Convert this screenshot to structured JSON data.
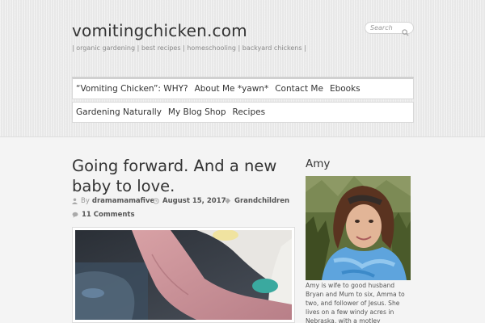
{
  "site": {
    "title": "vomitingchicken.com",
    "tagline": "| organic gardening | best recipes | homeschooling | backyard chickens |"
  },
  "search": {
    "placeholder": "Search"
  },
  "nav_primary": [
    "“Vomiting Chicken”: WHY?",
    "About Me *yawn*",
    "Contact Me",
    "Ebooks"
  ],
  "nav_secondary": [
    "Gardening Naturally",
    "My Blog Shop",
    "Recipes"
  ],
  "post": {
    "title": "Going forward. And a new baby to love.",
    "by_label": "By",
    "author": "dramamamafive",
    "date": "August 15, 2017",
    "category": "Grandchildren",
    "comments": "11 Comments"
  },
  "sidebar": {
    "title": "Amy",
    "bio": "Amy is wife to good husband Bryan and Mum to six, Amma to two, and follower of Jesus. She lives on a few windy acres in Nebraska, with a motley assortment of chickens, too many"
  },
  "colors": {
    "header_bg": "#ececec",
    "body_bg": "#f4f4f4",
    "text": "#333333",
    "muted": "#999999"
  },
  "icons": [
    "search-icon",
    "user-icon",
    "clock-icon",
    "tag-icon",
    "comment-icon"
  ]
}
